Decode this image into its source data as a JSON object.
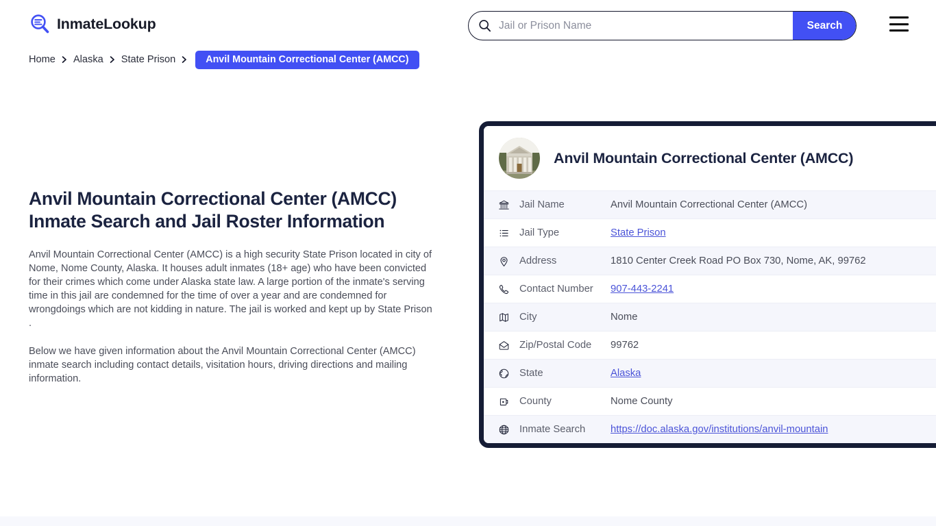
{
  "header": {
    "brand_name": "InmateLookup",
    "brand_icon": "magnifier-list-icon",
    "search": {
      "placeholder": "Jail or Prison Name",
      "value": "",
      "icon": "search-icon",
      "button_label": "Search"
    },
    "menu_icon": "hamburger-menu-icon"
  },
  "breadcrumb": {
    "items": [
      {
        "label": "Home"
      },
      {
        "label": "Alaska"
      },
      {
        "label": "State Prison"
      }
    ],
    "separator_icon": "chevron-right-icon",
    "current": "Anvil Mountain Correctional Center (AMCC)"
  },
  "main": {
    "title": "Anvil Mountain Correctional Center (AMCC) Inmate Search and Jail Roster Information",
    "paragraphs": [
      "Anvil Mountain Correctional Center (AMCC) is a high security State Prison located in city of Nome, Nome County, Alaska. It houses adult inmates (18+ age) who have been convicted for their crimes which come under Alaska state law. A large portion of the inmate's serving time in this jail are condemned for the time of over a year and are condemned for wrongdoings which are not kidding in nature. The jail is worked and kept up by State Prison .",
      "Below we have given information about the Anvil Mountain Correctional Center (AMCC) inmate search including contact details, visitation hours, driving directions and mailing information."
    ]
  },
  "info_card": {
    "avatar_icon": "courthouse-building-photo",
    "title": "Anvil Mountain Correctional Center (AMCC)",
    "rows": [
      {
        "icon": "bank-institution-icon",
        "label": "Jail Name",
        "value": "Anvil Mountain Correctional Center (AMCC)",
        "link": false
      },
      {
        "icon": "list-icon",
        "label": "Jail Type",
        "value": "State Prison",
        "link": true
      },
      {
        "icon": "location-pin-icon",
        "label": "Address",
        "value": "1810 Center Creek Road PO Box 730, Nome, AK, 99762",
        "link": false
      },
      {
        "icon": "phone-icon",
        "label": "Contact Number",
        "value": "907-443-2241",
        "link": true
      },
      {
        "icon": "map-icon",
        "label": "City",
        "value": "Nome",
        "link": false
      },
      {
        "icon": "envelope-icon",
        "label": "Zip/Postal Code",
        "value": "99762",
        "link": false
      },
      {
        "icon": "globe-americas-icon",
        "label": "State",
        "value": "Alaska",
        "link": true
      },
      {
        "icon": "county-marker-icon",
        "label": "County",
        "value": "Nome County",
        "link": false
      },
      {
        "icon": "globe-grid-icon",
        "label": "Inmate Search",
        "value": "https://doc.alaska.gov/institutions/anvil-mountain",
        "link": true
      }
    ]
  },
  "colors": {
    "accent": "#4250f4",
    "card_border": "#151c35",
    "link": "#4a53d8",
    "row_stripe": "#f5f6fc",
    "heading": "#1b2340"
  }
}
